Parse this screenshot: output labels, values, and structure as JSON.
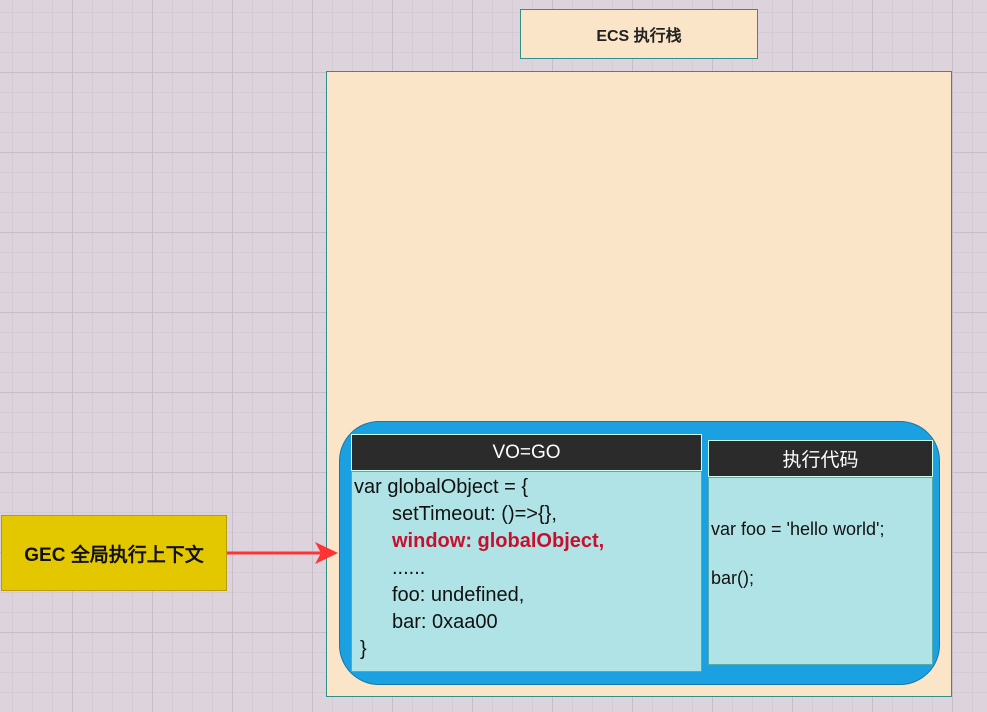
{
  "ecs": {
    "label": "ECS 执行栈"
  },
  "vo": {
    "header": "VO=GO",
    "lines": [
      "var globalObject = {",
      "setTimeout: ()=>{},",
      "window: globalObject,",
      "......",
      "foo: undefined,",
      "bar: 0xaa00",
      "}"
    ]
  },
  "exec": {
    "header": "执行代码",
    "lines": [
      "var foo = 'hello world';",
      "bar();"
    ]
  },
  "gec": {
    "label": "GEC 全局执行上下文"
  },
  "colors": {
    "stack_fill": "#fbe5c8",
    "container_fill": "#1ba1e2",
    "header_fill": "#2b2b2b",
    "body_fill": "#b0e3e6",
    "gec_fill": "#e3c800",
    "arrow": "#ff3333",
    "highlight_text": "#c8102e"
  }
}
